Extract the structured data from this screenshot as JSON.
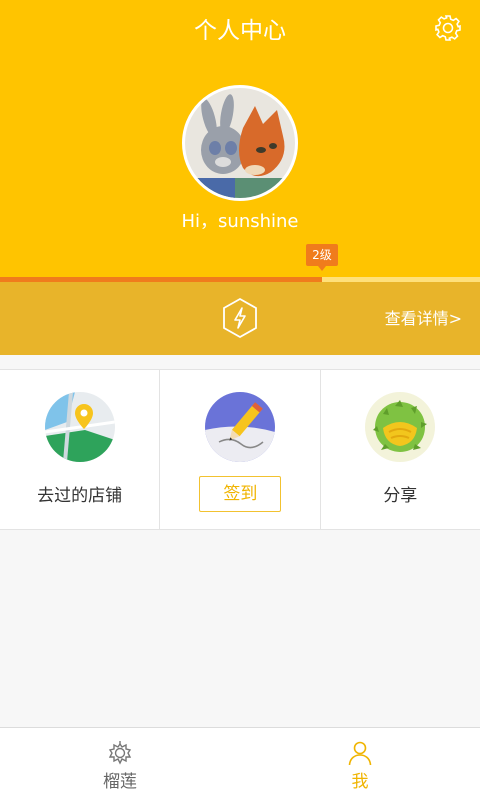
{
  "header": {
    "title": "个人中心",
    "greeting": "Hi，sunshine",
    "level_badge": "2级",
    "level_progress": 0.67,
    "details_link": "查看详情>"
  },
  "features": [
    {
      "label": "去过的店铺",
      "icon": "map-pin-icon"
    },
    {
      "label": "签到",
      "icon": "pencil-icon"
    },
    {
      "label": "分享",
      "icon": "durian-icon"
    }
  ],
  "tabbar": {
    "tabs": [
      {
        "label": "榴莲",
        "icon": "durian-outline-icon",
        "active": false
      },
      {
        "label": "我",
        "icon": "user-icon",
        "active": true
      }
    ]
  },
  "colors": {
    "header_bg": "#ffc400",
    "band_bg": "#e8b42a",
    "accent_orange": "#f07c1c",
    "active_tab": "#f0b400"
  }
}
